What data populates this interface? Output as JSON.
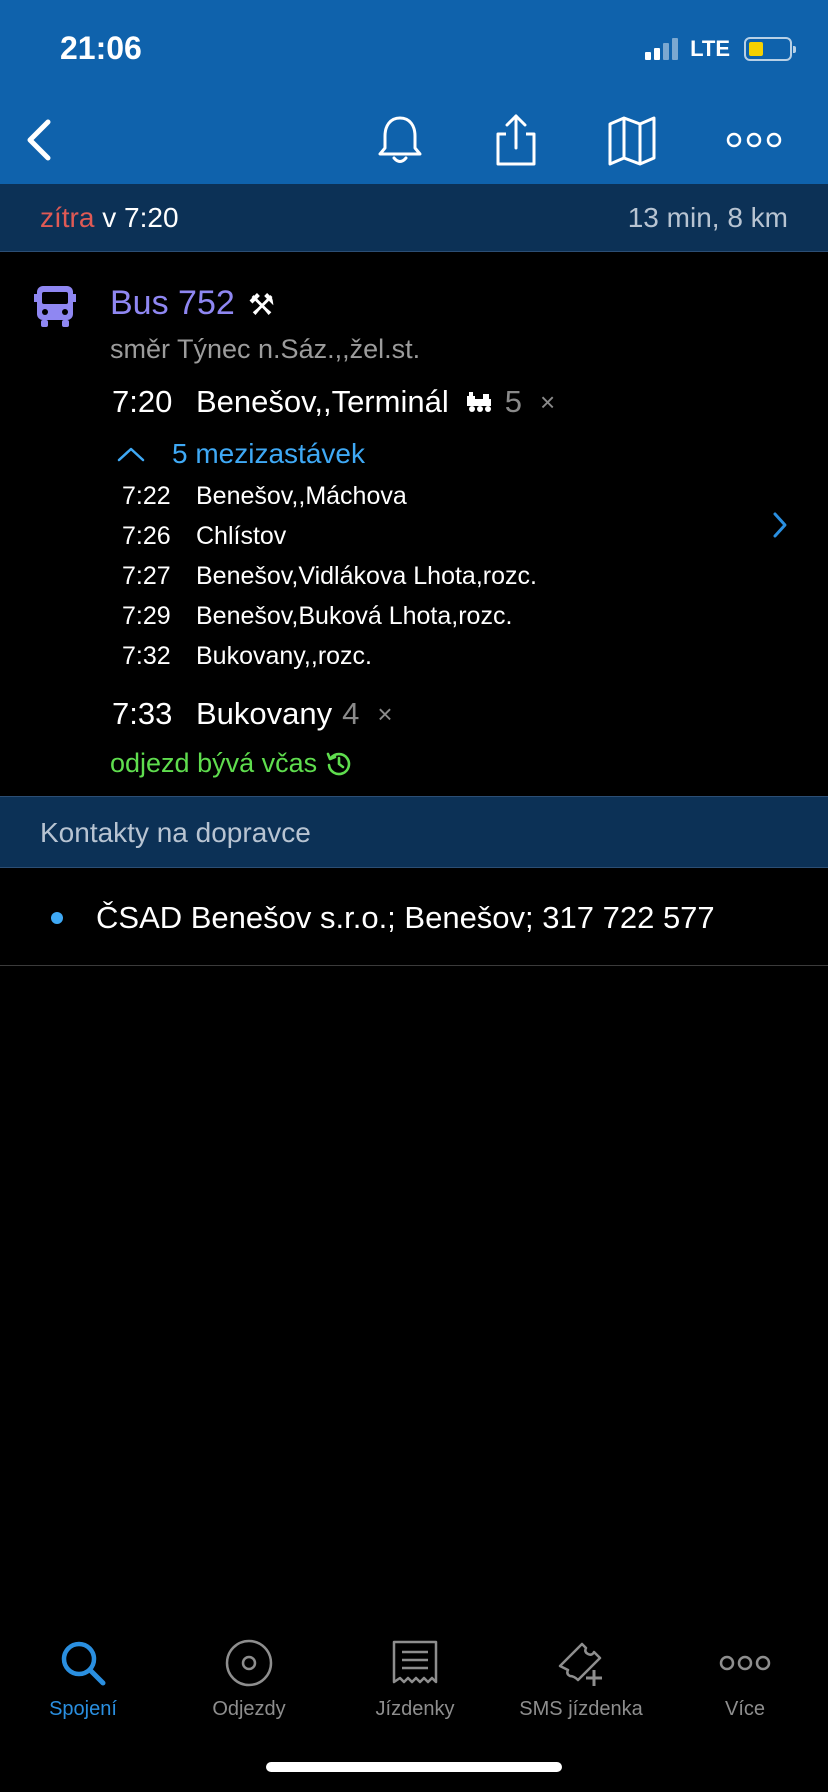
{
  "status_bar": {
    "time": "21:06",
    "network": "LTE",
    "battery_color": "#f6d100"
  },
  "nav": {
    "back_icon": "chevron-left-icon",
    "icons": [
      "bell-icon",
      "share-icon",
      "map-icon",
      "more-icon"
    ]
  },
  "summary": {
    "day": "zítra",
    "time_text": " v 7:20",
    "duration": "13 min, 8 km"
  },
  "connection": {
    "line": "Bus 752",
    "direction": "směr Týnec n.Sáz.,,žel.st.",
    "departure": {
      "time": "7:20",
      "stop": "Benešov,,Terminál",
      "platform": "5",
      "flag": "×"
    },
    "intermediate_toggle": "5 mezizastávek",
    "intermediate": [
      {
        "time": "7:22",
        "stop": "Benešov,,Máchova"
      },
      {
        "time": "7:26",
        "stop": "Chlístov"
      },
      {
        "time": "7:27",
        "stop": "Benešov,Vidlákova Lhota,rozc."
      },
      {
        "time": "7:29",
        "stop": "Benešov,Buková Lhota,rozc."
      },
      {
        "time": "7:32",
        "stop": "Bukovany,,rozc."
      }
    ],
    "arrival": {
      "time": "7:33",
      "stop": "Bukovany",
      "platform": "4",
      "flag": "×"
    },
    "punctuality": "odjezd bývá včas",
    "accent_color": "#8f87f2"
  },
  "contacts": {
    "title": "Kontakty na dopravce",
    "items": [
      "ČSAD Benešov s.r.o.; Benešov; 317 722 577"
    ]
  },
  "tabbar": {
    "tabs": [
      {
        "label": "Spojení",
        "icon": "search-icon",
        "active": true
      },
      {
        "label": "Odjezdy",
        "icon": "clock-circle-icon",
        "active": false
      },
      {
        "label": "Jízdenky",
        "icon": "ticket-icon",
        "active": false
      },
      {
        "label": "SMS jízdenka",
        "icon": "sms-ticket-icon",
        "active": false
      },
      {
        "label": "Více",
        "icon": "more-icon",
        "active": false
      }
    ],
    "active_color": "#2a8fe0"
  }
}
